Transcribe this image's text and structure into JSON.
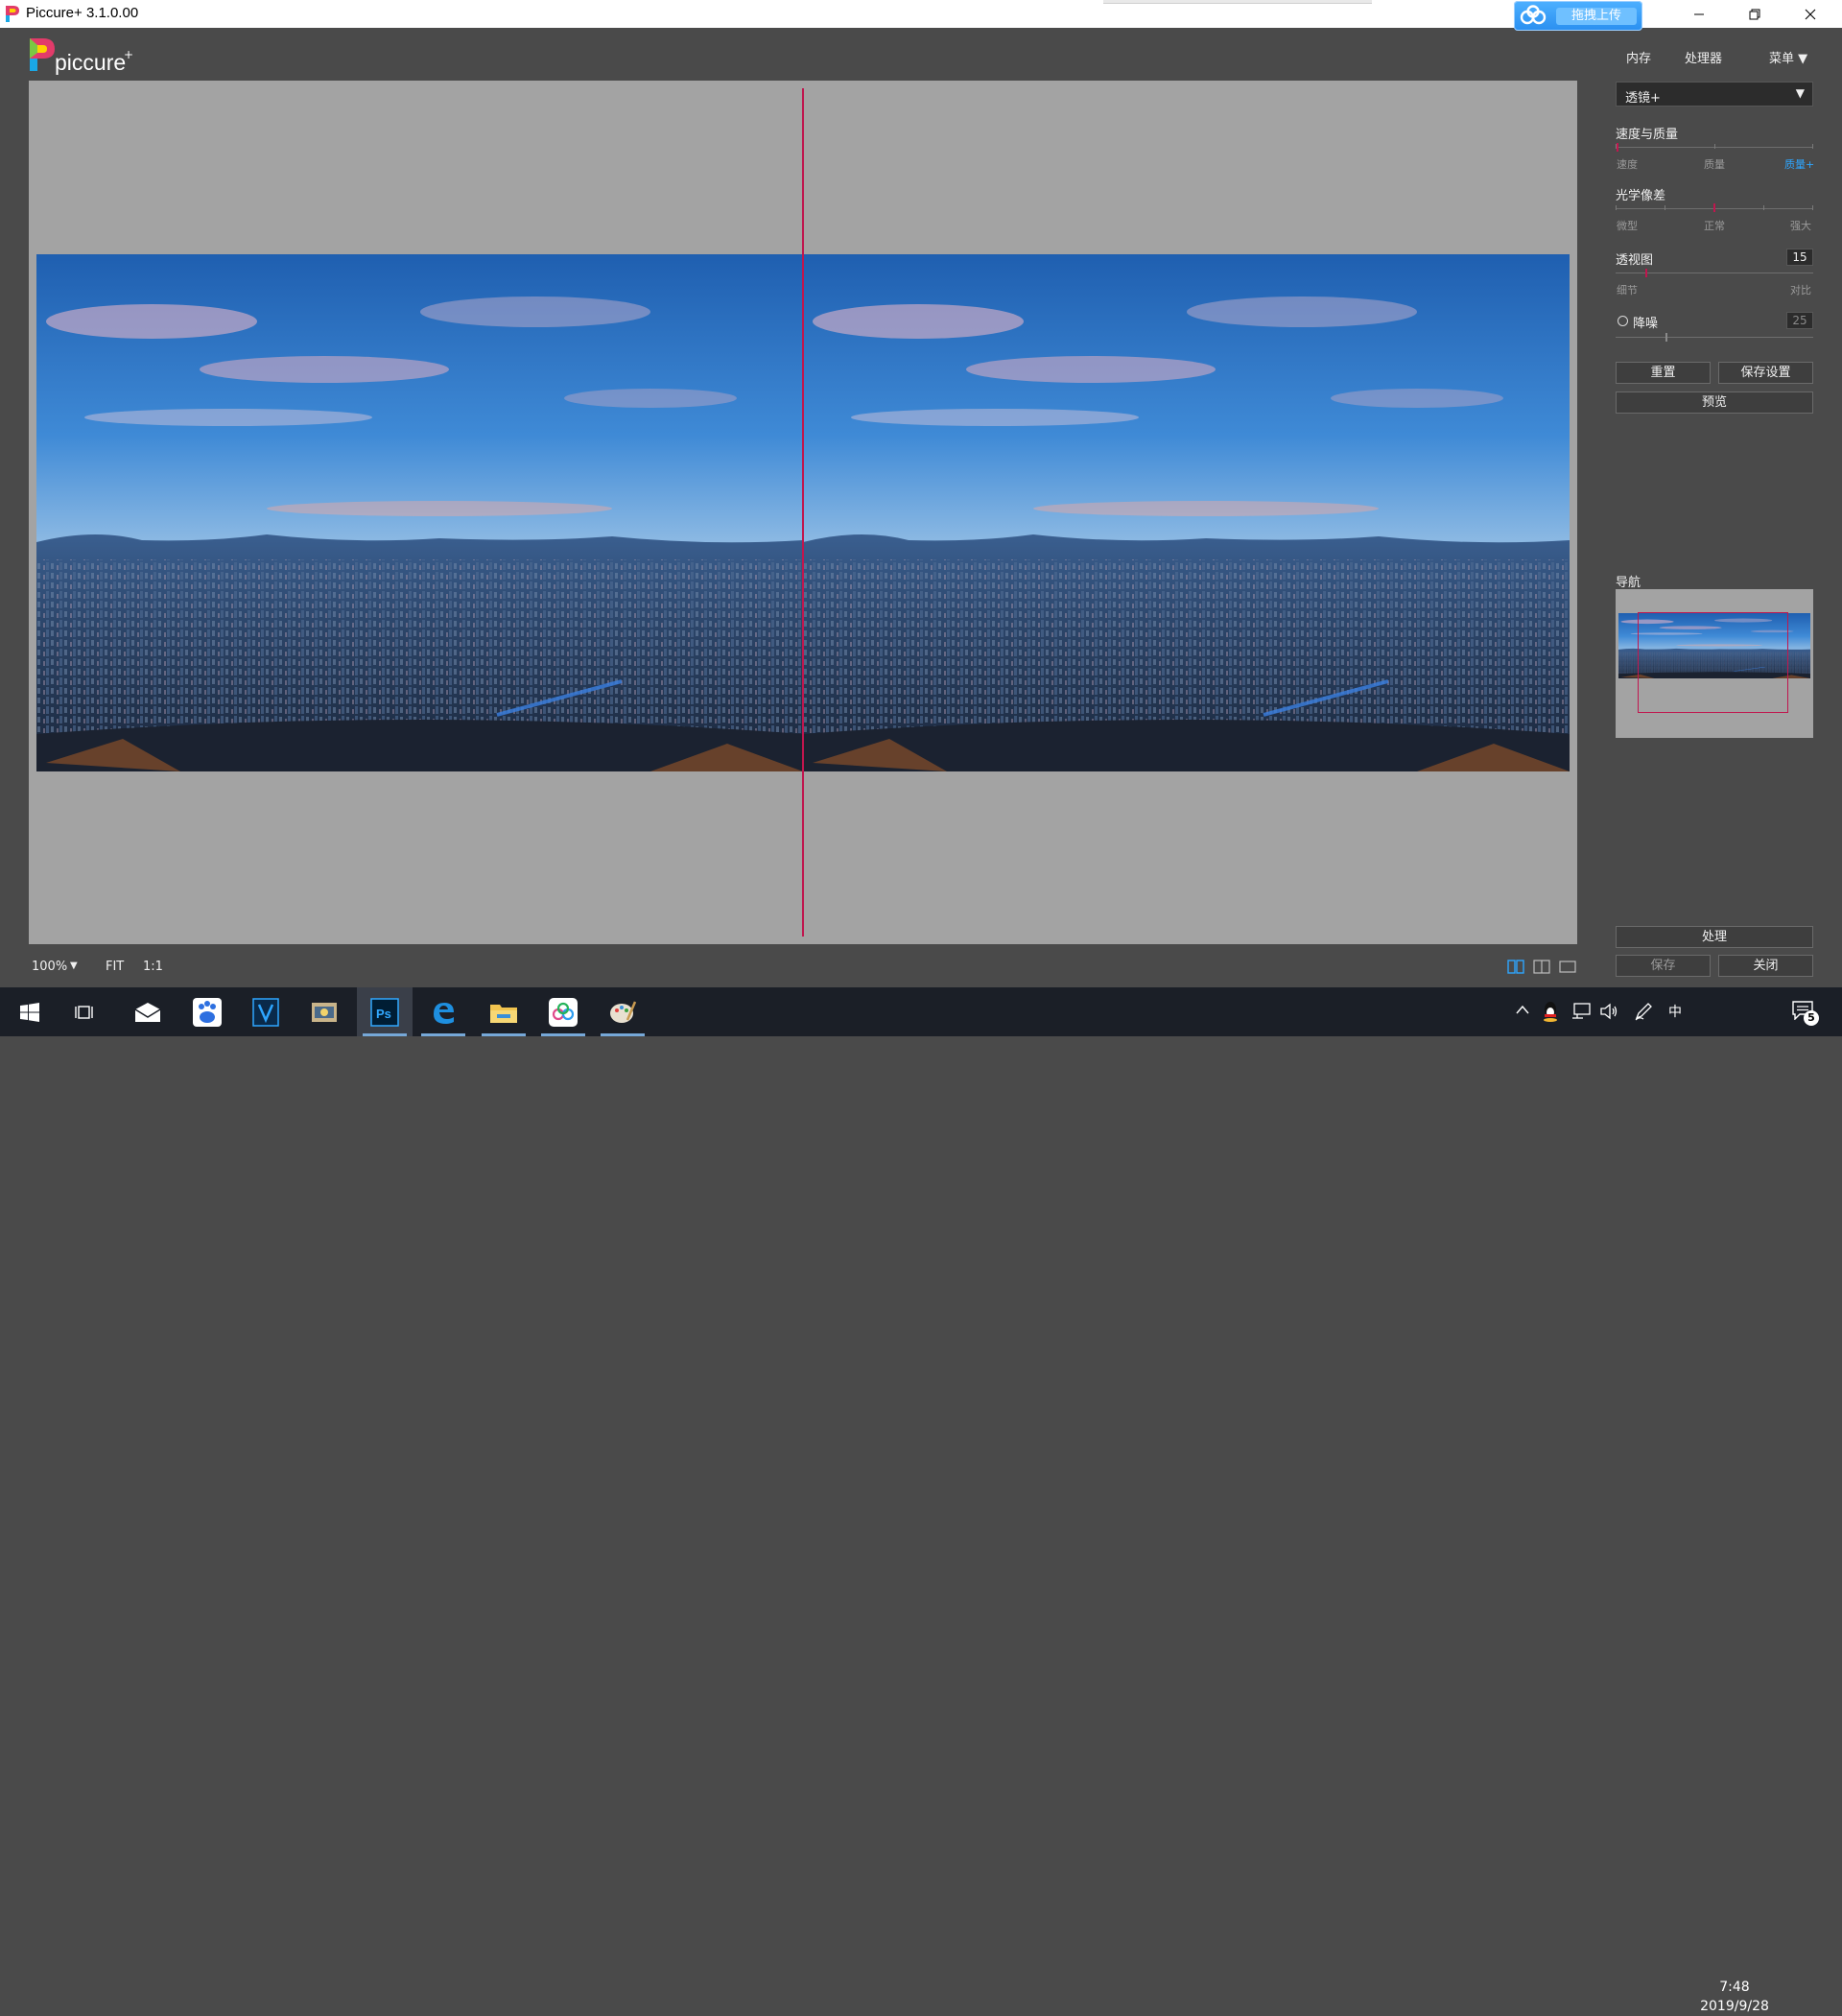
{
  "window": {
    "title": "Piccure+ 3.1.0.00"
  },
  "upload_widget": {
    "label": "拖拽上传"
  },
  "app": {
    "logo_text": "piccure",
    "logo_sup": "+"
  },
  "top_menu": {
    "memory": "内存",
    "processor": "处理器",
    "menu": "菜单 ▼"
  },
  "panel": {
    "mode_select": "透镜+",
    "speed_quality": {
      "title": "速度与质量",
      "labels": [
        "速度",
        "质量",
        "质量+"
      ],
      "selected": "质量+"
    },
    "optical_aberration": {
      "title": "光学像差",
      "labels": [
        "微型",
        "正常",
        "强大"
      ],
      "selected": "正常"
    },
    "perspective": {
      "title": "透视图",
      "value": "15",
      "labels": [
        "细节",
        "对比"
      ]
    },
    "denoise": {
      "title": "降噪",
      "value": "25",
      "enabled": false
    },
    "buttons": {
      "reset": "重置",
      "save_settings": "保存设置",
      "preview": "预览"
    },
    "navigator_title": "导航",
    "process": "处理",
    "save": "保存",
    "close": "关闭"
  },
  "bottom_toolbar": {
    "zoom": "100%",
    "zoom_caret": "▼",
    "fit": "FIT",
    "one_to_one": "1:1"
  },
  "taskbar": {
    "time": "7:48",
    "date": "2019/9/28",
    "ime": "中",
    "notifications": "5",
    "apps": [
      "start-icon",
      "task-view-icon",
      "mail-icon",
      "baidu-icon",
      "vegas-icon",
      "video-tool-icon",
      "photoshop-icon",
      "edge-icon",
      "file-explorer-icon",
      "cloud-drive-icon",
      "paint-icon"
    ]
  },
  "colors": {
    "accent": "#c0164e",
    "link_blue": "#2ea6ff",
    "canvas_bg": "#a3a3a3",
    "app_bg": "#4a4a4a"
  }
}
